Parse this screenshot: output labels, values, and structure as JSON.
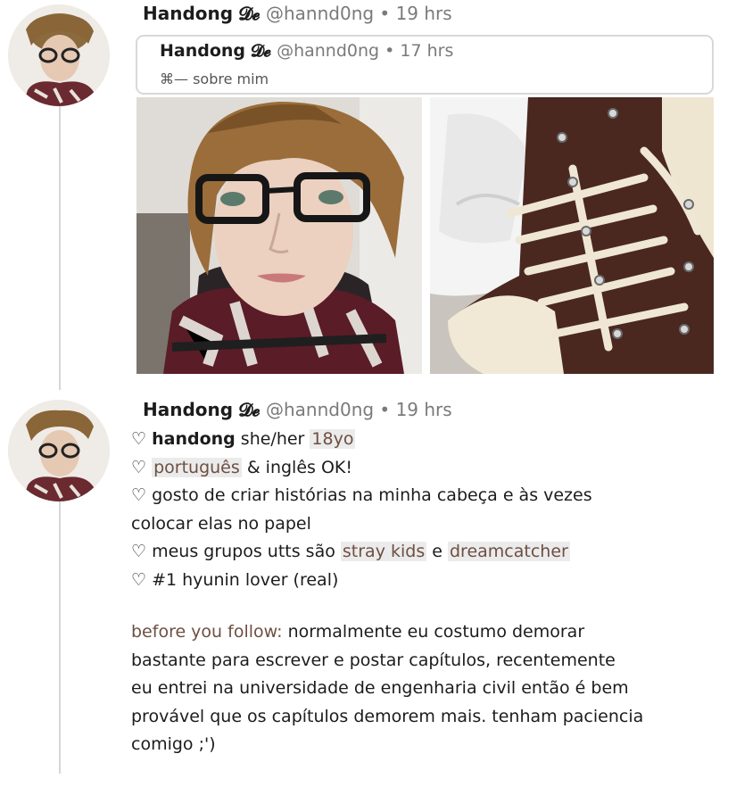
{
  "post1": {
    "name": "Handong",
    "emoji": "𝓓𝓮",
    "handle": "@hannd0ng",
    "separator": "•",
    "time": "19 hrs"
  },
  "quote": {
    "name": "Handong",
    "emoji": "𝓓𝓮",
    "handle": "@hannd0ng",
    "separator": "•",
    "time": "17 hrs",
    "symbol": "⌘",
    "text": "— sobre mim"
  },
  "post2": {
    "name": "Handong",
    "emoji": "𝓓𝓮",
    "handle": "@hannd0ng",
    "separator": "•",
    "time": "19 hrs"
  },
  "bio": {
    "heart": "♡",
    "l1_name": "handong",
    "l1_pronouns": " she/her ",
    "l1_age": "18yo",
    "l2_lang": "português",
    "l2_rest": " & inglês OK!",
    "l3a": " gosto de criar histórias na minha cabeça e às vezes",
    "l3b": "colocar elas no papel",
    "l4_pre": " meus grupos utts são ",
    "l4_g1": "stray kids",
    "l4_mid": " e ",
    "l4_g2": "dreamcatcher",
    "l5": " #1 hyunin lover (real)"
  },
  "note": {
    "label": "before you follow:",
    "l1": " normalmente eu costumo demorar",
    "l2": "bastante para escrever e postar capítulos, recentemente",
    "l3": "eu entrei na universidade de engenharia civil então é bem",
    "l4": "provável que os capítulos demorem mais. tenham paciencia",
    "l5": "comigo ;')"
  },
  "colors": {
    "accent": "#6e4f42",
    "highlight_bg": "#ebebeb",
    "muted": "#7a7a7a"
  }
}
